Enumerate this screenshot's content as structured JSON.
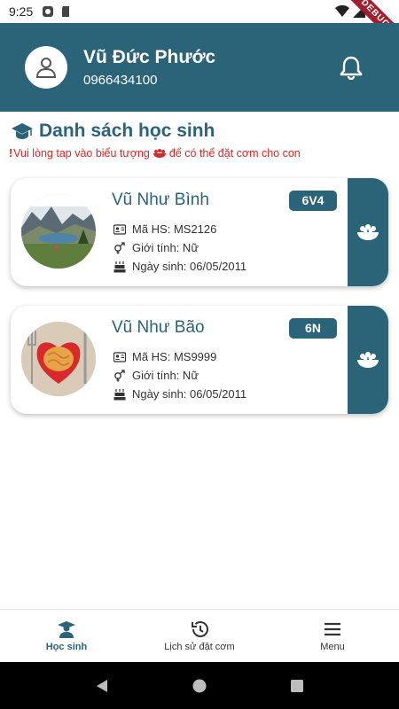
{
  "status_bar": {
    "time": "9:25",
    "debug_label": "DEBUG"
  },
  "header": {
    "user_name": "Vũ Đức Phước",
    "phone": "0966434100"
  },
  "section": {
    "title": "Danh sách học sinh",
    "hint_prefix": "!",
    "hint_before": "Vui lòng tap vào biểu tượng",
    "hint_after": "để có thể đặt cơm cho con"
  },
  "students": [
    {
      "name": "Vũ Như Bình",
      "class": "6V4",
      "student_id": "Mã HS: MS2126",
      "gender": "Giới tính: Nữ",
      "birthday": "Ngày sinh: 06/05/2011"
    },
    {
      "name": "Vũ Như Bão",
      "class": "6N",
      "student_id": "Mã HS: MS9999",
      "gender": "Giới tính: Nữ",
      "birthday": "Ngày sinh: 06/05/2011"
    }
  ],
  "bottom_nav": [
    {
      "label": "Học sinh",
      "icon": "student-graduate-icon",
      "active": true
    },
    {
      "label": "Lịch sử đặt cơm",
      "icon": "history-icon",
      "active": false
    },
    {
      "label": "Menu",
      "icon": "menu-icon",
      "active": false
    }
  ],
  "colors": {
    "primary": "#2b6379",
    "hint": "#d12b2b",
    "ribbon": "#a31d2f"
  }
}
